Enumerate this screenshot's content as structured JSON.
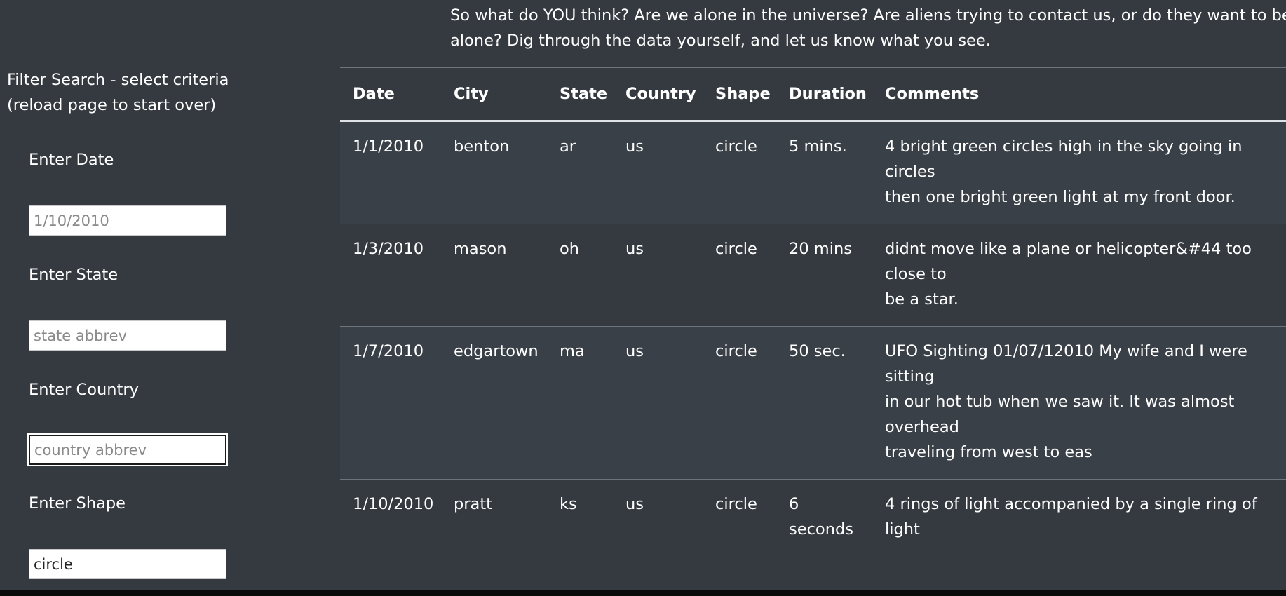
{
  "intro": {
    "line1": "So what do YOU think? Are we alone in the universe? Are aliens trying to contact us, or do they want to be left",
    "line2": "alone? Dig through the data yourself, and let us know what you see."
  },
  "sidebar": {
    "title": "Filter Search - select criteria",
    "subtitle": "(reload page to start over)",
    "fields": [
      {
        "label": "Enter Date",
        "value": "",
        "placeholder": "1/10/2010"
      },
      {
        "label": "Enter State",
        "value": "",
        "placeholder": "state abbrev"
      },
      {
        "label": "Enter Country",
        "value": "",
        "placeholder": "country abbrev"
      },
      {
        "label": "Enter Shape",
        "value": "circle",
        "placeholder": ""
      }
    ]
  },
  "table": {
    "headers": [
      "Date",
      "City",
      "State",
      "Country",
      "Shape",
      "Duration",
      "Comments"
    ],
    "rows": [
      {
        "date": "1/1/2010",
        "city": "benton",
        "state": "ar",
        "country": "us",
        "shape": "circle",
        "duration": [
          "5 mins."
        ],
        "comments": [
          "4 bright green circles high in the sky going in circles",
          "then one bright green light at my front door."
        ]
      },
      {
        "date": "1/3/2010",
        "city": "mason",
        "state": "oh",
        "country": "us",
        "shape": "circle",
        "duration": [
          "20 mins"
        ],
        "comments": [
          "didnt move like a plane or helicopter&#44 too close to",
          "be a star."
        ]
      },
      {
        "date": "1/7/2010",
        "city": "edgartown",
        "state": "ma",
        "country": "us",
        "shape": "circle",
        "duration": [
          "50 sec."
        ],
        "comments": [
          "UFO Sighting 01/07/12010 My wife and I were sitting",
          "in our hot tub when we saw it. It was almost overhead",
          "traveling from west to eas"
        ]
      },
      {
        "date": "1/10/2010",
        "city": "pratt",
        "state": "ks",
        "country": "us",
        "shape": "circle",
        "duration": [
          "6",
          "seconds"
        ],
        "comments": [
          "4 rings of light accompanied by a single ring of light"
        ]
      }
    ]
  }
}
